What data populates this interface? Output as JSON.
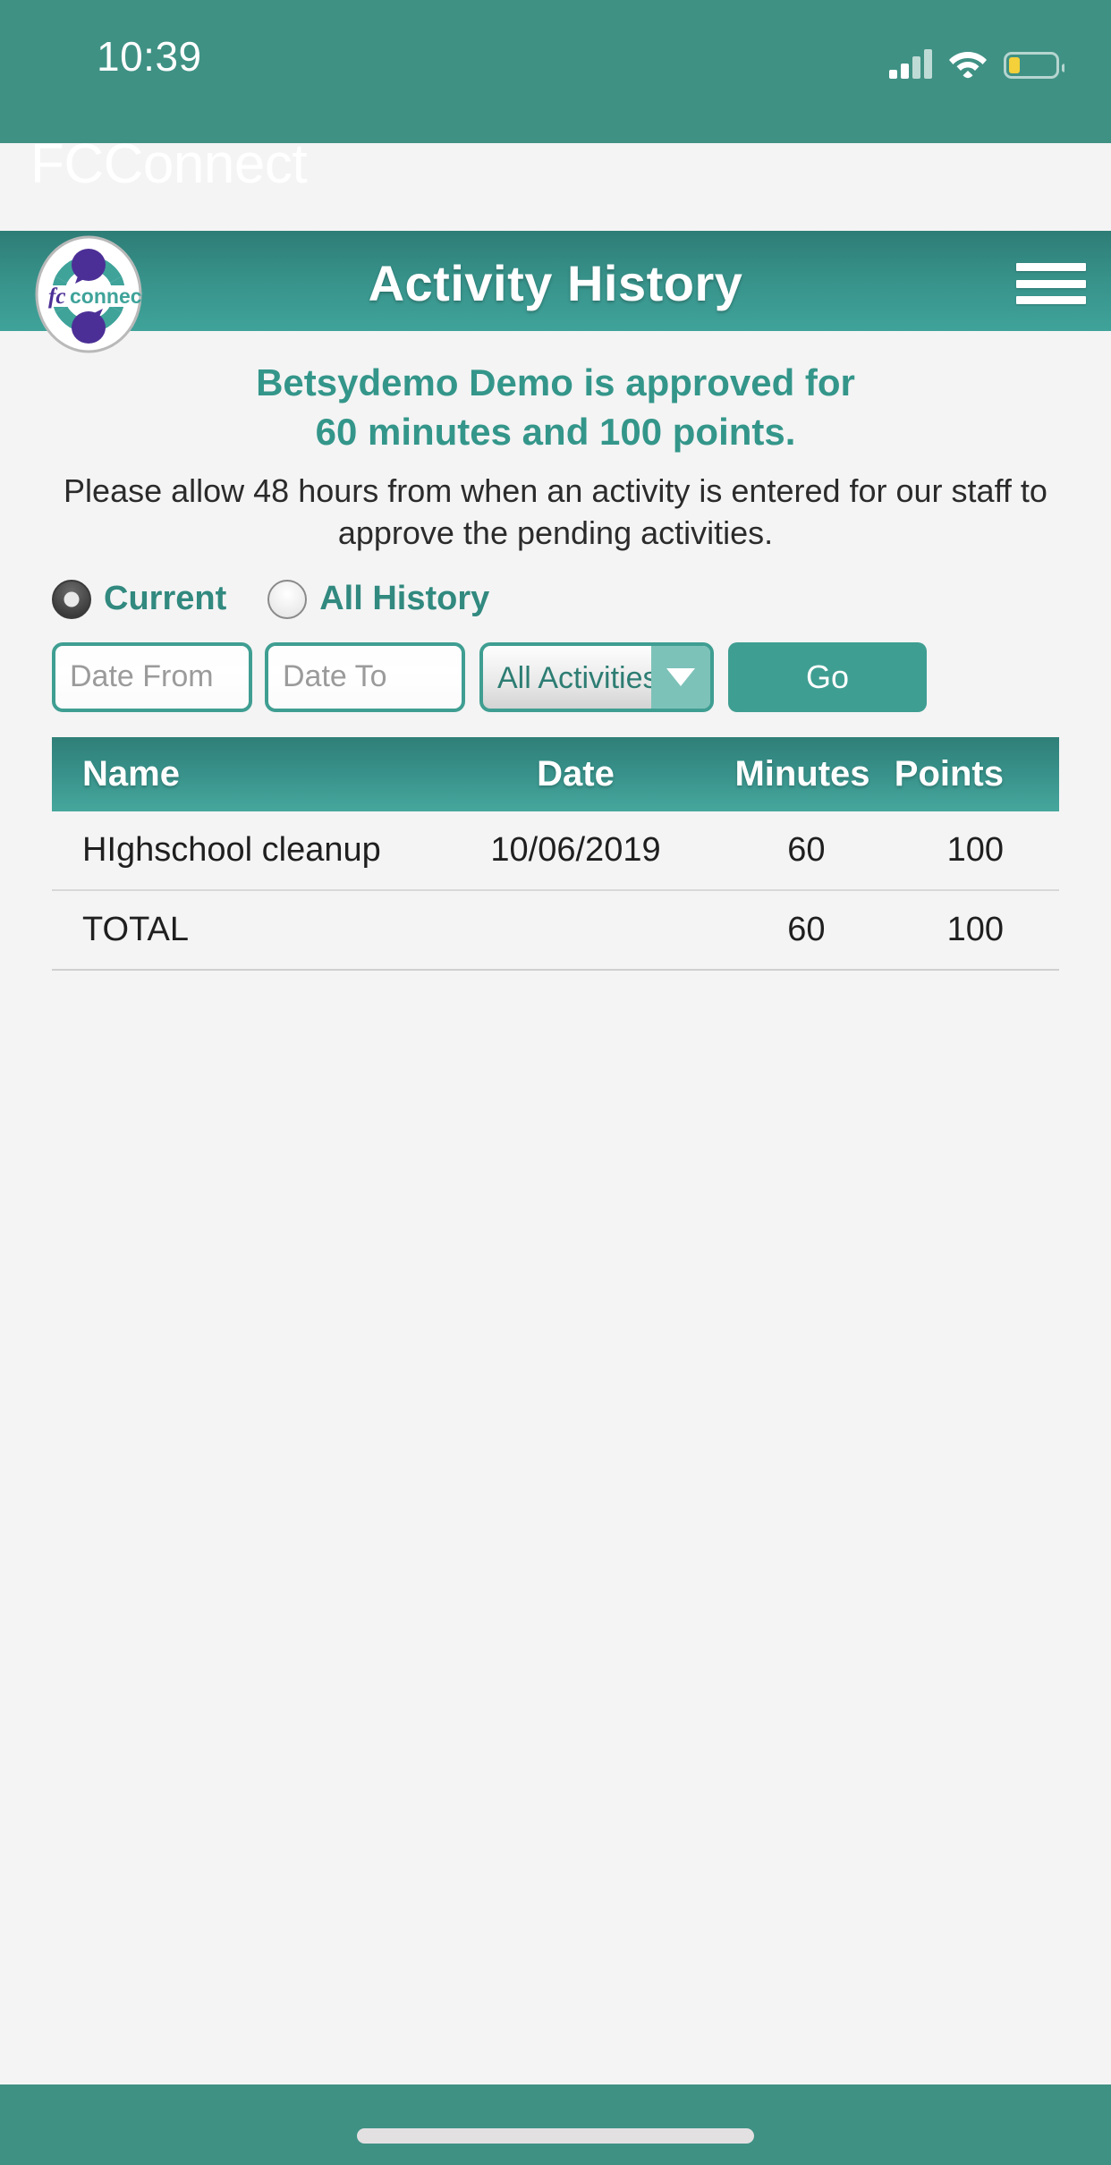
{
  "status_bar": {
    "time": "10:39",
    "signal_icon": "cellular-signal-icon",
    "wifi_icon": "wifi-icon",
    "battery_icon": "battery-low-icon",
    "battery_level_percent": 20
  },
  "app": {
    "name": "FCConnect",
    "brand_teal": "#3f9184",
    "accent_teal": "#34968a",
    "logo_alt": "fc connect"
  },
  "navbar": {
    "title": "Activity History",
    "menu_icon": "hamburger-menu-icon",
    "logo_icon": "fcconnect-logo-icon"
  },
  "banner": {
    "approved_line1": "Betsydemo Demo is approved for",
    "approved_line2": "60 minutes and 100 points.",
    "notice": "Please allow 48 hours from when an activity is entered for our staff to approve the pending activities."
  },
  "filters": {
    "scope_options": [
      {
        "label": "Current",
        "selected": true
      },
      {
        "label": "All History",
        "selected": false
      }
    ],
    "date_from": {
      "value": "",
      "placeholder": "Date From"
    },
    "date_to": {
      "value": "",
      "placeholder": "Date To"
    },
    "activity_select": {
      "selected": "All Activities",
      "arrow_icon": "chevron-down-icon"
    },
    "go_label": "Go"
  },
  "table": {
    "columns": [
      "Name",
      "Date",
      "Minutes",
      "Points"
    ],
    "rows": [
      {
        "name": "HIghschool cleanup",
        "date": "10/06/2019",
        "minutes": "60",
        "points": "100"
      }
    ],
    "total": {
      "name": "TOTAL",
      "date": "",
      "minutes": "60",
      "points": "100"
    }
  },
  "footer": {
    "home_indicator": "home-indicator"
  }
}
